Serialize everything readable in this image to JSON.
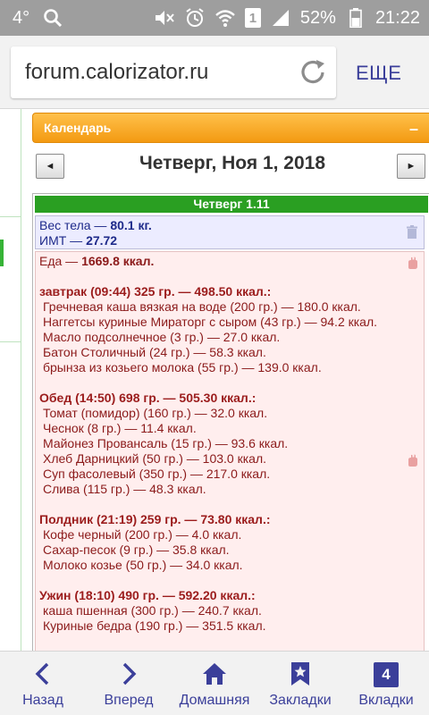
{
  "status_bar": {
    "temperature": "4°",
    "battery": "52%",
    "time": "21:22",
    "sim_badge": "1",
    "icons": [
      "search-icon",
      "mute-icon",
      "alarm-icon",
      "wifi-icon",
      "signal-icon",
      "battery-icon"
    ]
  },
  "browser": {
    "url": "forum.calorizator.ru",
    "more_label": "ЕЩЕ"
  },
  "calendar": {
    "title": "Календарь",
    "collapse_label": "–",
    "prev_label": "◄",
    "next_label": "►",
    "date_title": "Четверг, Ноя 1, 2018"
  },
  "day": {
    "header": "Четверг 1.11",
    "weight_label": "Вес тела — ",
    "weight_value": "80.1 кг.",
    "bmi_label": "ИМТ — ",
    "bmi_value": "27.72",
    "food_label": "Еда — ",
    "food_value": "1669.8 ккал.",
    "meals": [
      {
        "title": "завтрак (09:44) 325 гр. — 498.50 ккал.:",
        "items": [
          "Гречневая каша вязкая на воде (200 гр.) — 180.0 ккал.",
          "Наггетсы куриные Мираторг с сыром (43 гр.) — 94.2 ккал.",
          "Масло подсолнечное (3 гр.) — 27.0 ккал.",
          "Батон Столичный (24 гр.) — 58.3 ккал.",
          "брынза из козьего молока (55 гр.) — 139.0 ккал."
        ]
      },
      {
        "title": "Обед (14:50) 698 гр. — 505.30 ккал.:",
        "items": [
          "Томат (помидор) (160 гр.) — 32.0 ккал.",
          "Чеснок (8 гр.) — 11.4 ккал.",
          "Майонез Провансаль (15 гр.) — 93.6 ккал.",
          "Хлеб Дарницкий (50 гр.) — 103.0 ккал.",
          "Суп фасолевый (350 гр.) — 217.0 ккал.",
          "Слива (115 гр.) — 48.3 ккал."
        ]
      },
      {
        "title": "Полдник (21:19) 259 гр. — 73.80 ккал.:",
        "items": [
          "Кофе черный (200 гр.) — 4.0 ккал.",
          "Сахар-песок (9 гр.) — 35.8 ккал.",
          "Молоко козье (50 гр.) — 34.0 ккал."
        ]
      },
      {
        "title": "Ужин (18:10) 490 гр. — 592.20 ккал.:",
        "items": [
          "каша пшенная (300 гр.) — 240.7 ккал.",
          "Куриные бедра (190 гр.) — 351.5 ккал."
        ]
      }
    ]
  },
  "bottom_nav": {
    "back": "Назад",
    "forward": "Вперед",
    "home": "Домашняя",
    "bookmarks": "Закладки",
    "tabs": "Вкладки",
    "tab_count": "4"
  },
  "colors": {
    "accent": "#3b3f9a",
    "calendar_orange": "#f39a12",
    "day_green": "#2a9f22",
    "food_text": "#8b1a1a",
    "weight_text": "#1e2a8a"
  }
}
